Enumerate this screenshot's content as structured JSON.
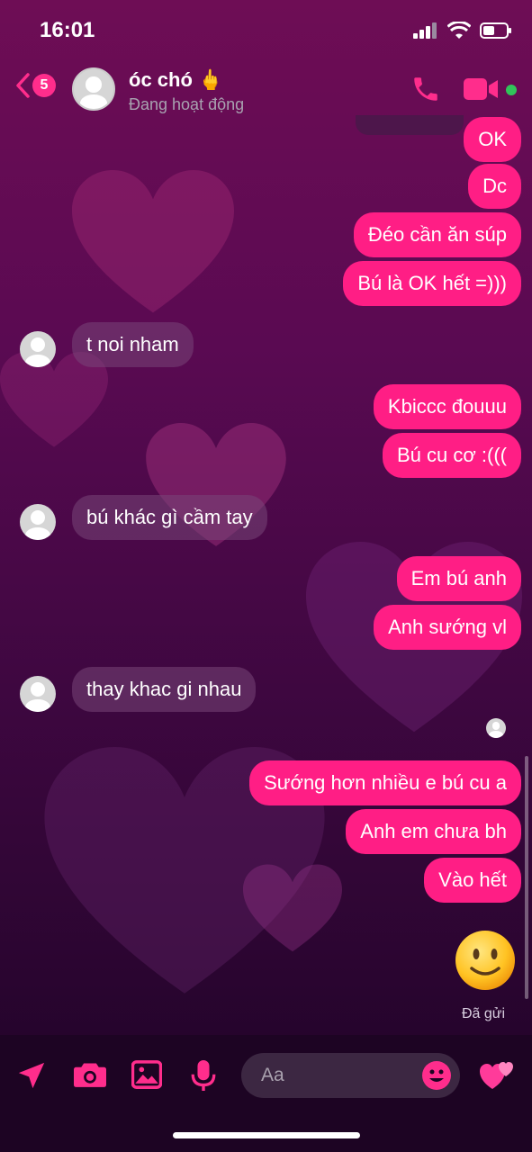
{
  "status_bar": {
    "time": "16:01"
  },
  "header": {
    "back_count": "5",
    "contact_name": "óc chó 🖕",
    "contact_status": "Đang hoạt động"
  },
  "messages": [
    {
      "dir": "out",
      "text": "OK"
    },
    {
      "dir": "out",
      "text": "Dc"
    },
    {
      "dir": "out",
      "text": "Đéo cần ăn súp"
    },
    {
      "dir": "out",
      "text": "Bú là OK hết =)))"
    },
    {
      "dir": "in",
      "text": "t noi nham"
    },
    {
      "dir": "out",
      "text": "Kbiccc đouuu"
    },
    {
      "dir": "out",
      "text": "Bú cu cơ :((("
    },
    {
      "dir": "in",
      "text": "bú khác gì cầm tay"
    },
    {
      "dir": "out",
      "text": "Em bú anh"
    },
    {
      "dir": "out",
      "text": "Anh sướng vl"
    },
    {
      "dir": "in",
      "text": "thay khac gi nhau"
    },
    {
      "dir": "out",
      "text": "Sướng hơn nhiều e bú cu a"
    },
    {
      "dir": "out",
      "text": "Anh em chưa bh"
    },
    {
      "dir": "out",
      "text": "Vào hết"
    }
  ],
  "sent_emoji": "slightly-smiling-face",
  "sent_status": "Đã gửi",
  "composer": {
    "placeholder": "Aa"
  },
  "colors": {
    "accent": "#ff1e85",
    "online": "#31c45a",
    "incoming_bubble": "#6a3a6e"
  }
}
